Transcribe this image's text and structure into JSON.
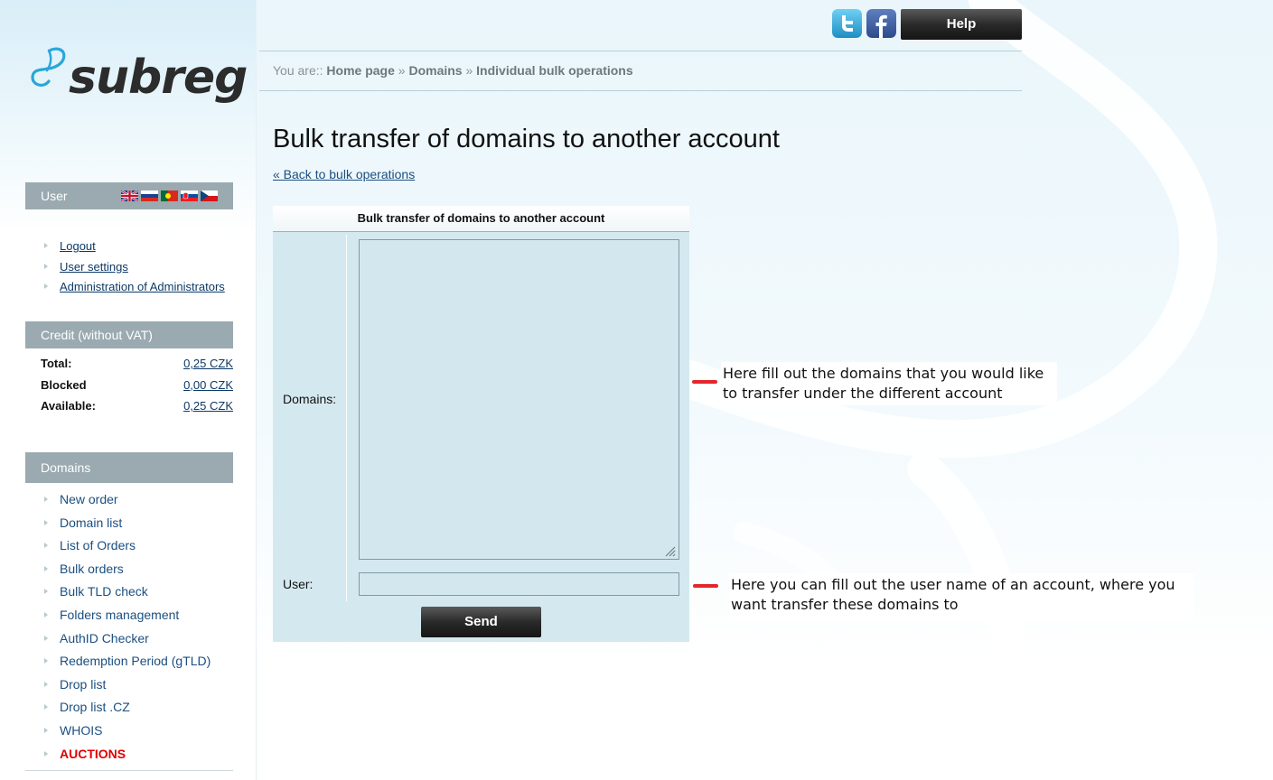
{
  "top": {
    "help_label": "Help",
    "social": [
      "twitter-icon",
      "facebook-icon"
    ],
    "brand_colors": {
      "twitter": "#36a8dc",
      "facebook": "#3b5998"
    }
  },
  "logo": {
    "text": "subreg"
  },
  "sidebar": {
    "user": {
      "title": "User",
      "languages": [
        "flag-en-icon",
        "flag-ru-icon",
        "flag-pt-icon",
        "flag-sk-icon",
        "flag-cz-icon"
      ],
      "links": [
        "Logout",
        "User settings",
        "Administration of Administrators"
      ]
    },
    "credit": {
      "title": "Credit (without VAT)",
      "rows": [
        {
          "label": "Total:",
          "value": "0,25 CZK"
        },
        {
          "label": "Blocked",
          "value": "0,00 CZK"
        },
        {
          "label": "Available:",
          "value": "0,25 CZK"
        }
      ]
    },
    "domains": {
      "title": "Domains",
      "items": [
        "New order",
        "Domain list",
        "List of Orders",
        "Bulk orders",
        "Bulk TLD check",
        "Folders management",
        "AuthID Checker",
        "Redemption Period (gTLD)",
        "Drop list",
        "Drop list .CZ",
        "WHOIS",
        "AUCTIONS"
      ]
    }
  },
  "breadcrumb": {
    "prefix": "You are::",
    "items": [
      "Home page",
      "Domains",
      "Individual bulk operations"
    ],
    "separator": "»"
  },
  "page": {
    "title": "Bulk transfer of domains to another account",
    "back_link": "« Back to bulk operations"
  },
  "form": {
    "header": "Bulk transfer of domains to another account",
    "domains_label": "Domains:",
    "domains_value": "",
    "user_label": "User:",
    "user_value": "",
    "send_label": "Send"
  },
  "annotations": {
    "domains_note": "Here fill out the domains that you would like to transfer under the different account",
    "user_note": "Here you can fill out the user name of an account, where you want transfer these domains to"
  },
  "colors": {
    "accent_red": "#e00000",
    "sidebar_header": "#9aaab0",
    "form_bg": "#d4e9ef",
    "link": "#1b4f80"
  }
}
